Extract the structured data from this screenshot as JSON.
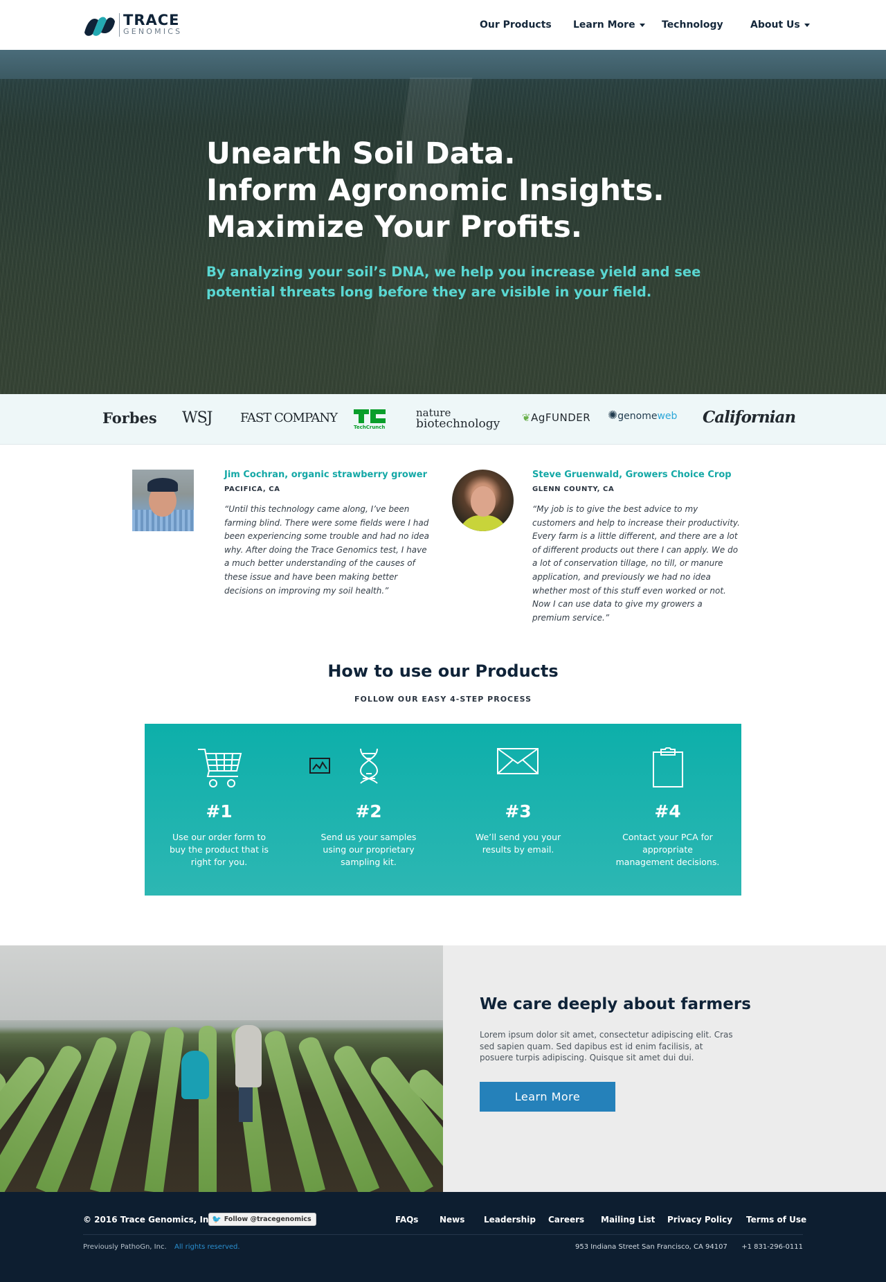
{
  "header": {
    "logo": {
      "word1": "TRACE",
      "word2": "GENOMICS"
    },
    "nav": [
      {
        "label": "Our Products",
        "dropdown": false
      },
      {
        "label": "Learn More",
        "dropdown": true
      },
      {
        "label": "Technology",
        "dropdown": false
      },
      {
        "label": "About Us",
        "dropdown": true
      }
    ]
  },
  "hero": {
    "headline": [
      "Unearth Soil Data.",
      "Inform Agronomic Insights.",
      "Maximize Your Profits."
    ],
    "subheadline": "By analyzing your soil’s DNA, we help you increase yield and see potential threats long before they are visible in your field."
  },
  "press": {
    "forbes": "Forbes",
    "wsj": "WSJ",
    "fastcompany": "FAST COMPANY",
    "techcrunch": "TechCrunch",
    "nature_top": "nature",
    "nature_bottom": "biotechnology",
    "agfunder": "AgFUNDER",
    "genomeweb_1": "genome",
    "genomeweb_2": "web",
    "californian": "Californian"
  },
  "testimonials": [
    {
      "name": "Jim Cochran, organic strawberry grower",
      "location": "PACIFICA, CA",
      "quote": "“Until this technology came along, I’ve been farming blind. There were some fields were I had been experiencing some trouble and had no idea why. After doing the Trace Genomics test, I have a much better understanding of the causes of these issue and have been making better decisions on improving my soil health.”"
    },
    {
      "name": "Steve Gruenwald, Growers Choice Crop",
      "location": "GLENN COUNTY, CA",
      "quote": "“My job is to give the best advice to my customers and help to increase their productivity. Every farm is a little different, and there are a lot of different products out there I can apply. We do a lot of conservation tillage, no till, or manure application, and previously we had no idea whether most of this stuff even worked or not. Now I can use data to give my growers a premium service.”"
    }
  ],
  "how": {
    "title": "How to use our Products",
    "subtitle": "FOLLOW OUR EASY 4-STEP PROCESS",
    "accent": "#0dafaa",
    "steps": [
      {
        "number": "#1",
        "text": "Use our order form to buy the product that is right for you.",
        "icon": "cart-icon"
      },
      {
        "number": "#2",
        "text": "Send us your samples using our proprietary sampling kit.",
        "icon": "dna-icon"
      },
      {
        "number": "#3",
        "text": "We’ll send you your results by email.",
        "icon": "envelope-icon"
      },
      {
        "number": "#4",
        "text": "Contact your PCA for appropriate management decisions.",
        "icon": "clipboard-icon"
      }
    ]
  },
  "farmers": {
    "title": "We care deeply about farmers",
    "body": "Lorem ipsum dolor sit amet, consectetur adipiscing elit. Cras sed sapien quam. Sed dapibus est id enim facilisis, at posuere turpis adipiscing. Quisque sit amet dui dui.",
    "button": "Learn More",
    "button_color": "#2581ba"
  },
  "footer": {
    "copyright": "© 2016 Trace Genomics, Inc.",
    "follow": "Follow @tracegenomics",
    "links": [
      "FAQs",
      "News",
      "Leadership",
      "Careers",
      "Mailing List",
      "Privacy Policy",
      "Terms of  Use"
    ],
    "previously": "Previously PathoGn, Inc.",
    "rights": "All rights reserved.",
    "address": "953 Indiana Street  San Francisco, CA 94107",
    "phone": "+1 831-296-0111"
  }
}
